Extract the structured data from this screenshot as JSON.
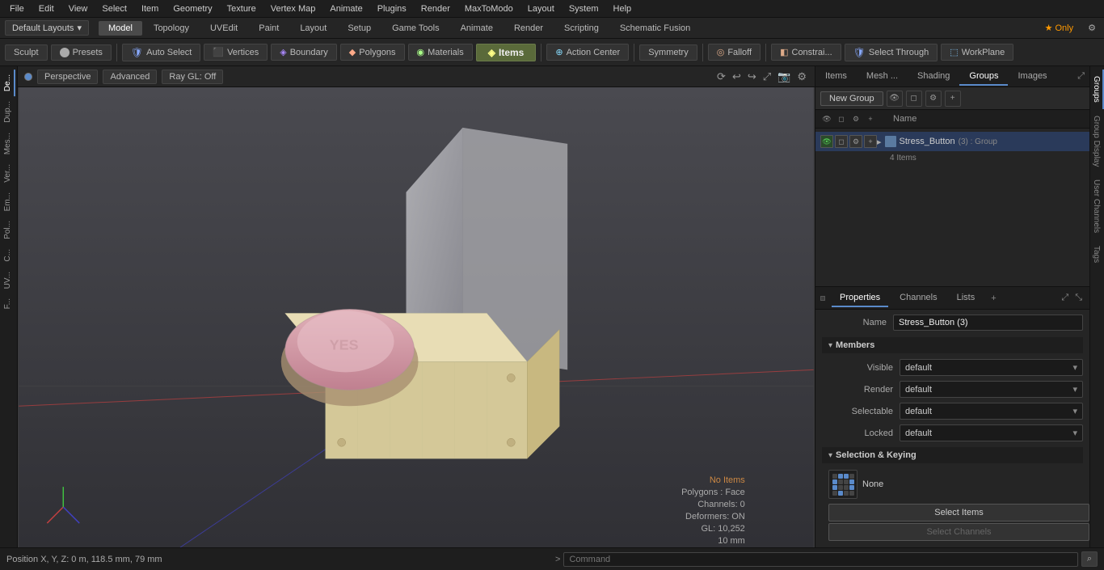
{
  "menu": {
    "items": [
      "File",
      "Edit",
      "View",
      "Select",
      "Item",
      "Geometry",
      "Texture",
      "Vertex Map",
      "Animate",
      "Plugins",
      "Render",
      "MaxToModo",
      "Layout",
      "System",
      "Help"
    ]
  },
  "layout_bar": {
    "dropdown_label": "Default Layouts",
    "tabs": [
      "Model",
      "Topology",
      "UVEdit",
      "Paint",
      "Layout",
      "Setup",
      "Game Tools",
      "Animate",
      "Render",
      "Scripting",
      "Schematic Fusion"
    ],
    "active_tab": "Model",
    "star_label": "★ Only",
    "plus_label": "+"
  },
  "toolbar": {
    "sculpt_label": "Sculpt",
    "presets_label": "Presets",
    "auto_select_label": "Auto Select",
    "vertices_label": "Vertices",
    "boundary_label": "Boundary",
    "polygons_label": "Polygons",
    "materials_label": "Materials",
    "items_label": "Items",
    "action_center_label": "Action Center",
    "symmetry_label": "Symmetry",
    "falloff_label": "Falloff",
    "constrain_label": "Constrai...",
    "select_through_label": "Select Through",
    "workplane_label": "WorkPlane"
  },
  "viewport": {
    "indicator_label": "•",
    "view_mode": "Perspective",
    "draw_mode": "Advanced",
    "ray_gl": "Ray GL: Off",
    "status": {
      "no_items": "No Items",
      "polygons": "Polygons : Face",
      "channels": "Channels: 0",
      "deformers": "Deformers: ON",
      "gl": "GL: 10,252",
      "size": "10 mm"
    },
    "expand_icon": "⤢"
  },
  "left_tabs": [
    "De...",
    "Dup...",
    "Mes...",
    "Ver...",
    "Em...",
    "Pol...",
    "C...",
    "UV...",
    "F..."
  ],
  "right_panel": {
    "tabs": [
      "Items",
      "Mesh ...",
      "Shading",
      "Groups",
      "Images"
    ],
    "active_tab": "Groups"
  },
  "groups": {
    "new_group_btn": "New Group",
    "header_name": "Name",
    "items": [
      {
        "name": "Stress_Button",
        "suffix": "(3) : Group",
        "sub_label": "4 Items",
        "selected": true
      }
    ]
  },
  "properties": {
    "tabs": [
      "Properties",
      "Channels",
      "Lists"
    ],
    "active_tab": "Properties",
    "add_tab": "+",
    "name_label": "Name",
    "name_value": "Stress_Button (3)",
    "members_section": "Members",
    "visible_label": "Visible",
    "visible_value": "default",
    "render_label": "Render",
    "render_value": "default",
    "selectable_label": "Selectable",
    "selectable_value": "default",
    "locked_label": "Locked",
    "locked_value": "default",
    "sel_keying_section": "Selection & Keying",
    "keying_none_label": "None",
    "select_items_btn": "Select Items",
    "select_channels_btn": "Select Channels"
  },
  "right_vtabs": [
    "Groups",
    "Group Display",
    "User Channels",
    "Tags"
  ],
  "bottom": {
    "position": "Position X, Y, Z:  0 m, 118.5 mm, 79 mm",
    "cmd_arrow": ">",
    "cmd_placeholder": "Command",
    "search_placeholder": "⌕"
  }
}
